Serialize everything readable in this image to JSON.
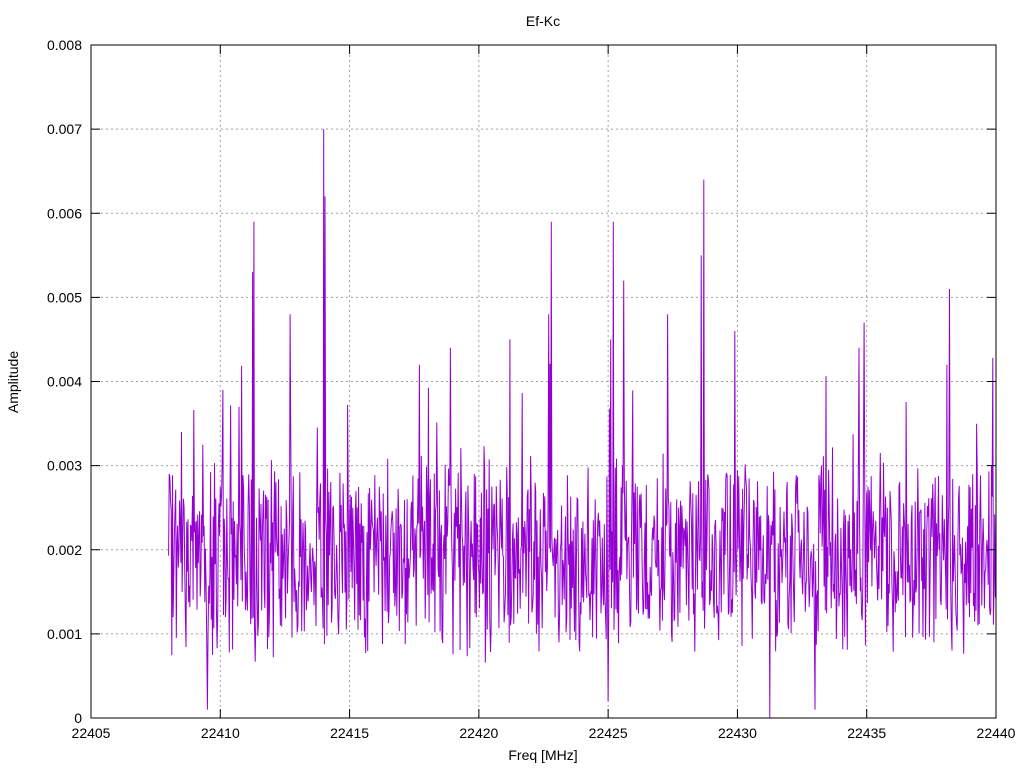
{
  "chart_data": {
    "type": "line",
    "title": "Ef-Kc",
    "xlabel": "Freq [MHz]",
    "ylabel": "Amplitude",
    "xlim": [
      22405,
      22440
    ],
    "ylim": [
      0,
      0.008
    ],
    "x_ticks": [
      "22405",
      "22410",
      "22415",
      "22420",
      "22425",
      "22430",
      "22435",
      "22440"
    ],
    "y_ticks": [
      "0",
      "0.001",
      "0.002",
      "0.003",
      "0.004",
      "0.005",
      "0.006",
      "0.007",
      "0.008"
    ],
    "grid": true,
    "line_color": "#9400d3",
    "x_start": 22408,
    "x_end": 22440,
    "x_step": 0.025,
    "baseline": 0.0019,
    "noise_amplitude": 0.0009,
    "peaks": [
      {
        "x": 22408.5,
        "y": 0.0034
      },
      {
        "x": 22410.1,
        "y": 0.0039
      },
      {
        "x": 22411.3,
        "y": 0.0059
      },
      {
        "x": 22411.25,
        "y": 0.0053
      },
      {
        "x": 22412.7,
        "y": 0.0048
      },
      {
        "x": 22414.0,
        "y": 0.007
      },
      {
        "x": 22414.05,
        "y": 0.0062
      },
      {
        "x": 22417.7,
        "y": 0.0042
      },
      {
        "x": 22418.9,
        "y": 0.0044
      },
      {
        "x": 22421.2,
        "y": 0.0045
      },
      {
        "x": 22422.7,
        "y": 0.0048
      },
      {
        "x": 22422.8,
        "y": 0.0059
      },
      {
        "x": 22425.2,
        "y": 0.0059
      },
      {
        "x": 22425.1,
        "y": 0.0045
      },
      {
        "x": 22425.6,
        "y": 0.0052
      },
      {
        "x": 22427.3,
        "y": 0.0048
      },
      {
        "x": 22428.7,
        "y": 0.0064
      },
      {
        "x": 22428.6,
        "y": 0.0055
      },
      {
        "x": 22429.9,
        "y": 0.0046
      },
      {
        "x": 22434.9,
        "y": 0.0047
      },
      {
        "x": 22434.7,
        "y": 0.0044
      },
      {
        "x": 22438.2,
        "y": 0.0051
      },
      {
        "x": 22438.1,
        "y": 0.0042
      }
    ],
    "dips": [
      {
        "x": 22409.5,
        "y": 0.0001
      },
      {
        "x": 22431.25,
        "y": 0.0
      },
      {
        "x": 22433.0,
        "y": 0.0001
      },
      {
        "x": 22425.0,
        "y": 0.0002
      }
    ]
  }
}
